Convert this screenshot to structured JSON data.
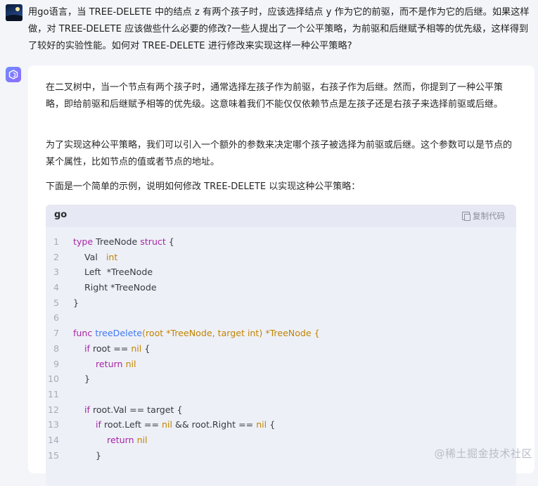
{
  "question": "用go语言，当 TREE-DELETE 中的结点 z 有两个孩子时，应该选择结点 y 作为它的前驱，而不是作为它的后继。如果这样做，对 TREE-DELETE 应该做些什么必要的修改?一些人提出了一个公平策略，为前驱和后继赋予相等的优先级，这样得到了较好的实验性能。如何对 TREE-DELETE 进行修改来实现这样一种公平策略?",
  "answer": {
    "paragraphs": [
      "在二叉树中，当一个节点有两个孩子时，通常选择左孩子作为前驱，右孩子作为后继。然而，你提到了一种公平策略，即给前驱和后继赋予相等的优先级。这意味着我们不能仅仅依赖节点是左孩子还是右孩子来选择前驱或后继。",
      "为了实现这种公平策略，我们可以引入一个额外的参数来决定哪个孩子被选择为前驱或后继。这个参数可以是节点的某个属性，比如节点的值或者节点的地址。",
      "下面是一个简单的示例，说明如何修改 TREE-DELETE 以实现这种公平策略："
    ],
    "code": {
      "language": "go",
      "copy_label": "复制代码",
      "lines": [
        {
          "n": "1",
          "tokens": [
            {
              "t": "type",
              "c": "kw"
            },
            {
              "t": " TreeNode "
            },
            {
              "t": "struct",
              "c": "kw"
            },
            {
              "t": " {"
            }
          ]
        },
        {
          "n": "2",
          "tokens": [
            {
              "t": "    Val   "
            },
            {
              "t": "int",
              "c": "ty"
            }
          ]
        },
        {
          "n": "3",
          "tokens": [
            {
              "t": "    Left  *TreeNode"
            }
          ]
        },
        {
          "n": "4",
          "tokens": [
            {
              "t": "    Right *TreeNode"
            }
          ]
        },
        {
          "n": "5",
          "tokens": [
            {
              "t": "}"
            }
          ]
        },
        {
          "n": "6",
          "tokens": []
        },
        {
          "n": "7",
          "tokens": [
            {
              "t": "func",
              "c": "kw"
            },
            {
              "t": " "
            },
            {
              "t": "treeDelete",
              "c": "fn"
            },
            {
              "t": "(root *TreeNode, target ",
              "c": "ty"
            },
            {
              "t": "int",
              "c": "ty"
            },
            {
              "t": ") *TreeNode {",
              "c": "ty"
            }
          ]
        },
        {
          "n": "8",
          "tokens": [
            {
              "t": "    "
            },
            {
              "t": "if",
              "c": "kw"
            },
            {
              "t": " root == "
            },
            {
              "t": "nil",
              "c": "ty"
            },
            {
              "t": " {"
            }
          ]
        },
        {
          "n": "9",
          "tokens": [
            {
              "t": "        "
            },
            {
              "t": "return",
              "c": "kw"
            },
            {
              "t": " "
            },
            {
              "t": "nil",
              "c": "ty"
            }
          ]
        },
        {
          "n": "10",
          "tokens": [
            {
              "t": "    }"
            }
          ]
        },
        {
          "n": "11",
          "tokens": []
        },
        {
          "n": "12",
          "tokens": [
            {
              "t": "    "
            },
            {
              "t": "if",
              "c": "kw"
            },
            {
              "t": " root.Val == target {"
            }
          ]
        },
        {
          "n": "13",
          "tokens": [
            {
              "t": "        "
            },
            {
              "t": "if",
              "c": "kw"
            },
            {
              "t": " root.Left == "
            },
            {
              "t": "nil",
              "c": "ty"
            },
            {
              "t": " && root.Right == "
            },
            {
              "t": "nil",
              "c": "ty"
            },
            {
              "t": " {"
            }
          ]
        },
        {
          "n": "14",
          "tokens": [
            {
              "t": "            "
            },
            {
              "t": "return",
              "c": "kw"
            },
            {
              "t": " "
            },
            {
              "t": "nil",
              "c": "ty"
            }
          ]
        },
        {
          "n": "15",
          "tokens": [
            {
              "t": "        }"
            }
          ]
        }
      ]
    }
  },
  "watermark": "@稀土掘金技术社区",
  "colors": {
    "keyword": "#a626a4",
    "type": "#c18401",
    "function": "#4078f2",
    "card": "#ffffff",
    "background": "#f4f5f9",
    "code_bg": "#eef0f7"
  },
  "icons": {
    "bot_avatar": "ai-assistant-icon",
    "copy": "copy-icon"
  }
}
